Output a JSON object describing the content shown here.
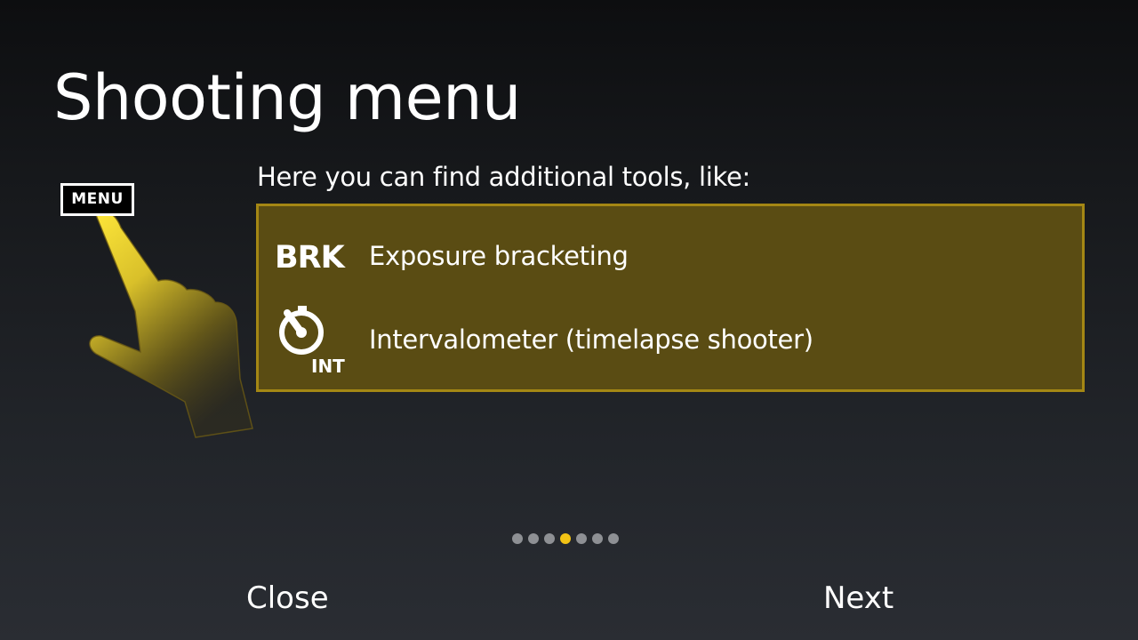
{
  "title": "Shooting menu",
  "menu_badge": "MENU",
  "intro": "Here you can find additional tools, like:",
  "tools": [
    {
      "icon": "brk-icon",
      "badge": "BRK",
      "label": "Exposure bracketing"
    },
    {
      "icon": "timer-icon",
      "badge": "INT",
      "label": "Intervalometer (timelapse shooter)"
    }
  ],
  "pagination": {
    "total": 7,
    "current": 4
  },
  "buttons": {
    "close": "Close",
    "next": "Next"
  },
  "colors": {
    "accent": "#f2c315",
    "box_fill": "#5a4c13",
    "box_border": "#a48714",
    "dot_inactive": "#8e9094"
  }
}
